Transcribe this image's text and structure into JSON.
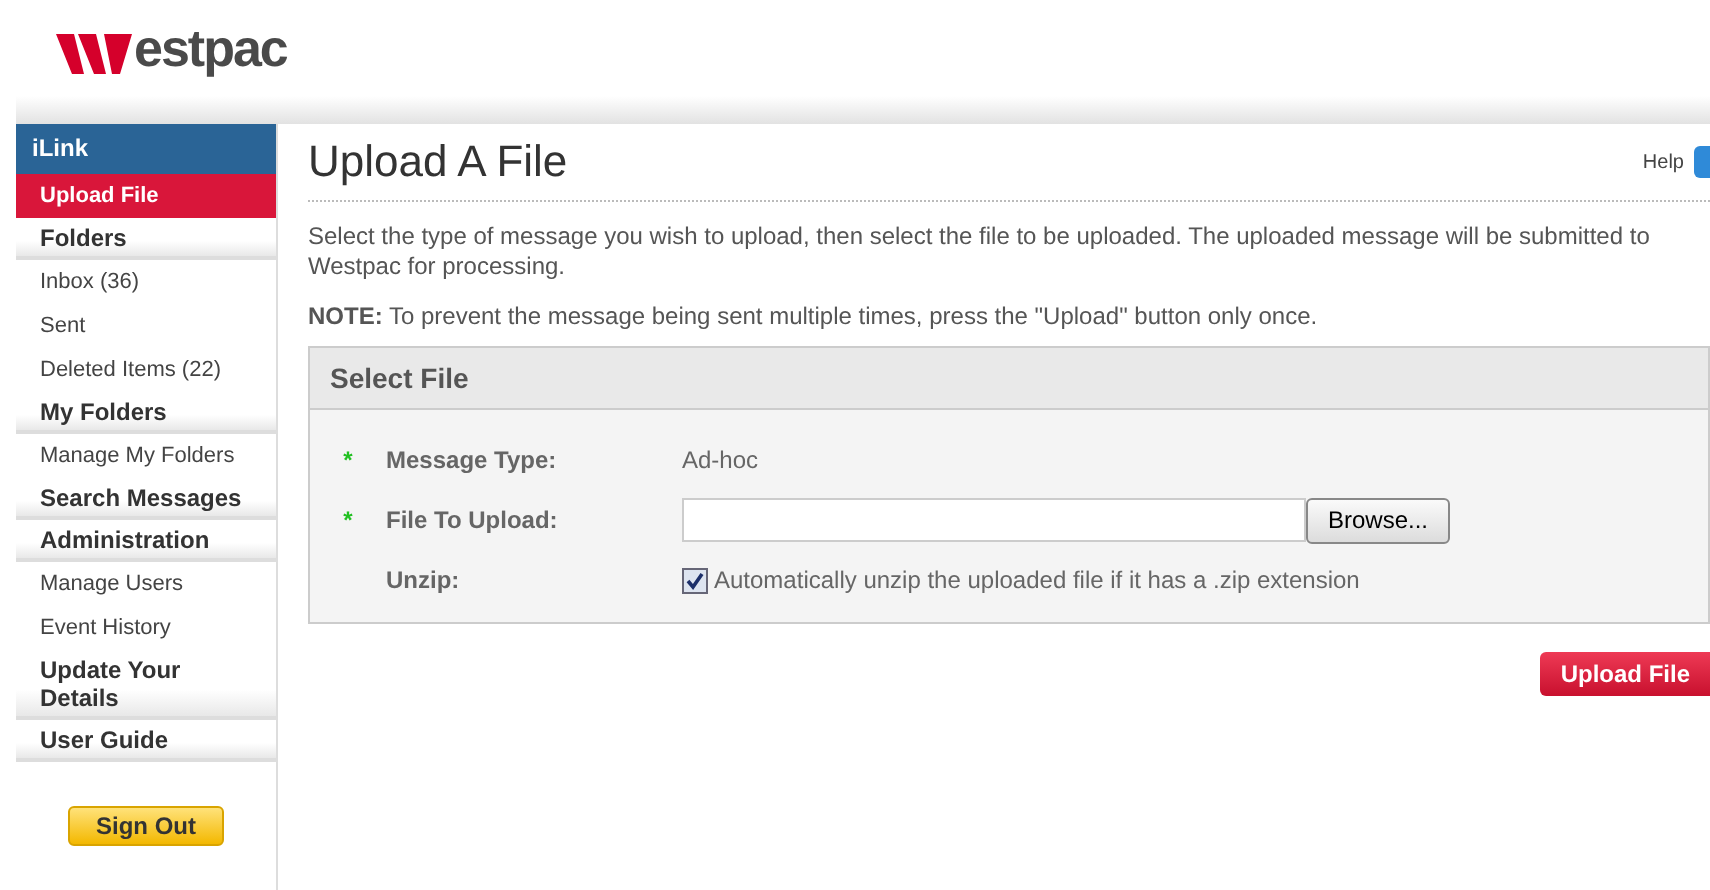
{
  "logo": {
    "text": "estpac"
  },
  "sidebar": {
    "title": "iLink",
    "items": [
      {
        "kind": "link",
        "label": "Upload File",
        "selected": true
      },
      {
        "kind": "header",
        "label": "Folders",
        "selected": false
      },
      {
        "kind": "link",
        "label": "Inbox (36)",
        "selected": false
      },
      {
        "kind": "link",
        "label": "Sent",
        "selected": false
      },
      {
        "kind": "link",
        "label": "Deleted Items (22)",
        "selected": false
      },
      {
        "kind": "header",
        "label": "My Folders",
        "selected": false
      },
      {
        "kind": "link",
        "label": "Manage My Folders",
        "selected": false
      },
      {
        "kind": "header",
        "label": "Search Messages",
        "selected": false
      },
      {
        "kind": "header",
        "label": "Administration",
        "selected": false
      },
      {
        "kind": "link",
        "label": "Manage Users",
        "selected": false
      },
      {
        "kind": "link",
        "label": "Event History",
        "selected": false
      },
      {
        "kind": "header",
        "label": "Update Your Details",
        "selected": false
      },
      {
        "kind": "header",
        "label": "User Guide",
        "selected": false
      }
    ],
    "sign_out": "Sign Out"
  },
  "page": {
    "title": "Upload A File",
    "help": "Help",
    "intro": "Select the type of message you wish to upload, then select the file to be uploaded. The uploaded message will be submitted to Westpac for processing.",
    "note": "**NOTE:** To prevent the message being sent multiple times, press the \"Upload\" button only once.",
    "panel": {
      "title": "Select File",
      "rows": [
        {
          "kind": "text",
          "marker": "*",
          "label": "Message Type:",
          "value": "Ad-hoc"
        },
        {
          "kind": "file",
          "marker": "*",
          "label": "File To Upload:",
          "button": "Browse..."
        },
        {
          "kind": "checkbox",
          "label": "Unzip:",
          "checked": true,
          "text": "Automatically unzip the uploaded file if it has a .zip extension"
        }
      ]
    },
    "submit": "Upload File"
  }
}
